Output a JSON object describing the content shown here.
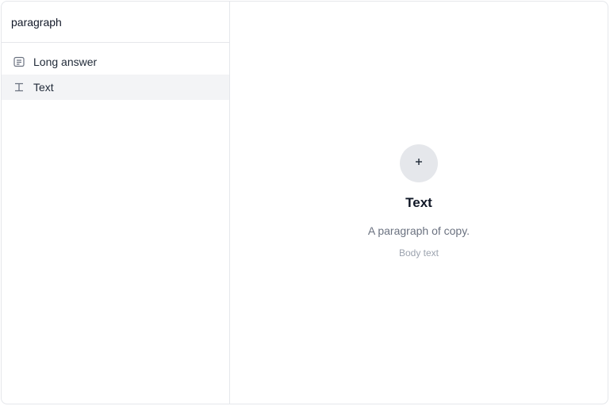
{
  "search": {
    "value": "paragraph"
  },
  "results": [
    {
      "label": "Long answer",
      "icon": "long-answer-icon",
      "selected": false
    },
    {
      "label": "Text",
      "icon": "text-type-icon",
      "selected": true
    }
  ],
  "preview": {
    "icon": "plus-icon",
    "title": "Text",
    "description": "A paragraph of copy.",
    "subtitle": "Body text"
  },
  "colors": {
    "selected_bg": "#f3f4f6",
    "border": "#e5e7eb",
    "muted_text": "#6b7280"
  }
}
